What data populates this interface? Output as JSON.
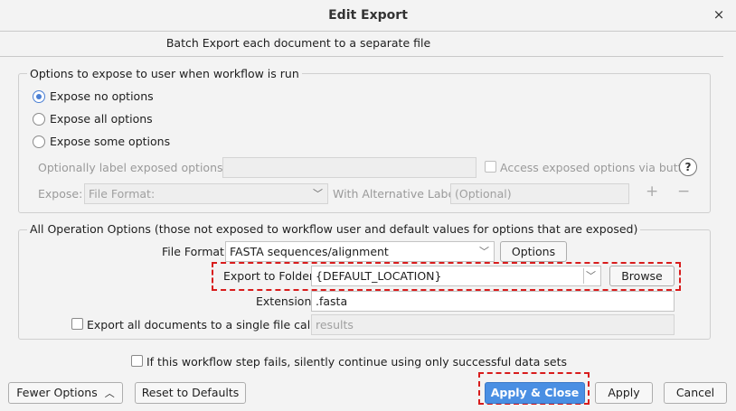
{
  "dialog": {
    "title": "Edit Export",
    "close_glyph": "×",
    "subtitle": "Batch Export each document to a separate file"
  },
  "expose_group": {
    "legend": "Options to expose to user when workflow is run",
    "radios": [
      {
        "label": "Expose no options",
        "selected": true
      },
      {
        "label": "Expose all options",
        "selected": false
      },
      {
        "label": "Expose some options",
        "selected": false
      }
    ],
    "label_prompt": "Optionally label exposed options as:",
    "label_value": "",
    "access_checkbox_label": "Access exposed options via button",
    "help_glyph": "?",
    "expose_label": "Expose:",
    "expose_value": "File Format:",
    "alt_label": "With Alternative Label:",
    "alt_placeholder": "(Optional)",
    "add_glyph": "+",
    "remove_glyph": "−"
  },
  "operation_group": {
    "legend": "All Operation Options (those not exposed to workflow user and default values for options that are exposed)",
    "file_format_label": "File Format:",
    "file_format_value": "FASTA sequences/alignment",
    "options_button": "Options",
    "export_folder_label": "Export to Folder:",
    "export_folder_value": "{DEFAULT_LOCATION}",
    "browse_button": "Browse",
    "extension_label": "Extension:",
    "extension_value": ".fasta",
    "single_file_label": "Export all documents to a single file called:",
    "single_file_value": "results"
  },
  "fail_checkbox_label": "If this workflow step fails, silently continue using only successful data sets",
  "footer": {
    "fewer_options": "Fewer Options",
    "reset": "Reset to Defaults",
    "apply_close": "Apply & Close",
    "apply": "Apply",
    "cancel": "Cancel"
  },
  "colors": {
    "accent": "#4a8fe3",
    "highlight": "#d81c1c"
  }
}
